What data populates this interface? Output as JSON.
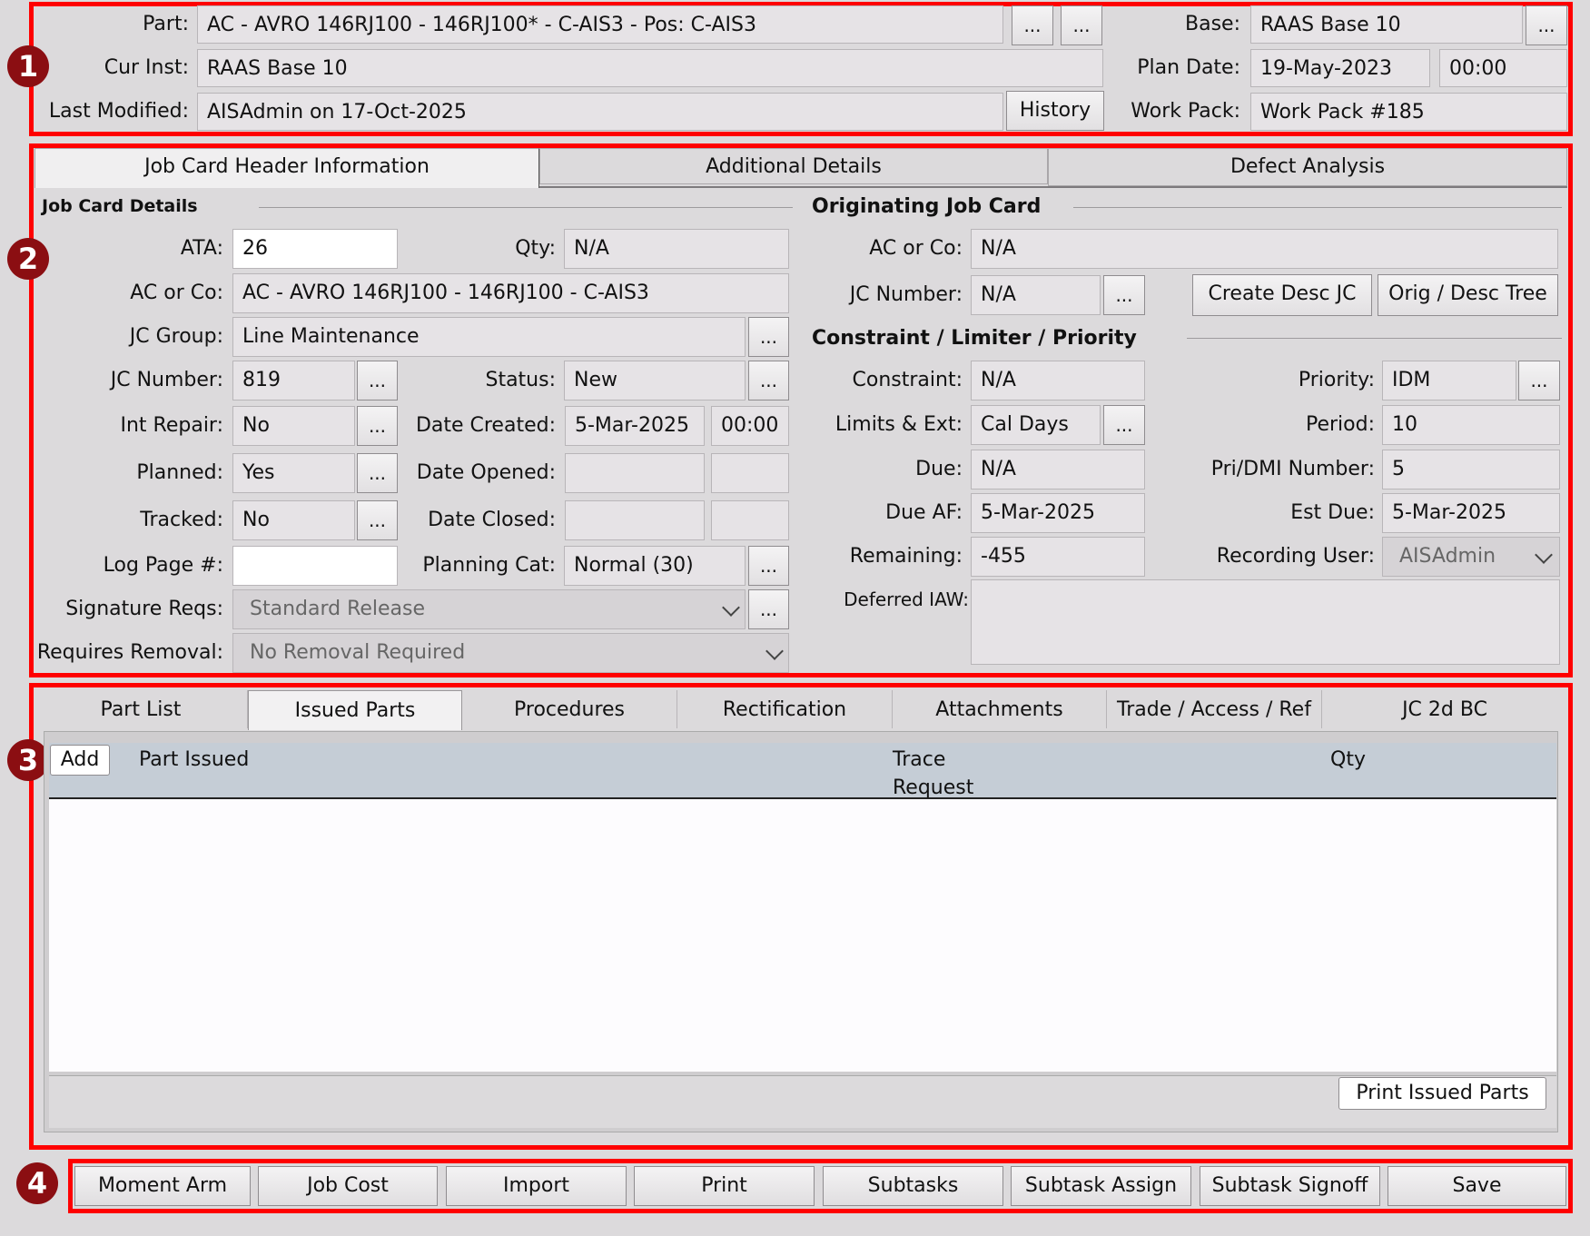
{
  "header": {
    "part_label": "Part:",
    "part_value": "AC - AVRO 146RJ100 - 146RJ100* - C-AIS3 - Pos: C-AIS3",
    "cur_inst_label": "Cur Inst:",
    "cur_inst_value": "RAAS Base 10",
    "last_modified_label": "Last Modified:",
    "last_modified_value": "AISAdmin on 17-Oct-2025",
    "history_button": "History",
    "base_label": "Base:",
    "base_value": "RAAS Base 10",
    "plan_date_label": "Plan Date:",
    "plan_date_value": "19-May-2023",
    "plan_time_value": "00:00",
    "work_pack_label": "Work Pack:",
    "work_pack_value": "Work Pack #185",
    "ellipsis": "..."
  },
  "badges": [
    "1",
    "2",
    "3",
    "4"
  ],
  "top_tabs": [
    "Job Card Header Information",
    "Additional Details",
    "Defect Analysis"
  ],
  "job_card_details": {
    "section_title": "Job Card Details",
    "ata_label": "ATA:",
    "ata_value": "26",
    "qty_label": "Qty:",
    "qty_value": "N/A",
    "ac_or_co_label": "AC or Co:",
    "ac_or_co_value": "AC - AVRO 146RJ100 - 146RJ100 - C-AIS3",
    "jc_group_label": "JC Group:",
    "jc_group_value": "Line Maintenance",
    "jc_number_label": "JC Number:",
    "jc_number_value": "819",
    "status_label": "Status:",
    "status_value": "New",
    "int_repair_label": "Int Repair:",
    "int_repair_value": "No",
    "date_created_label": "Date Created:",
    "date_created_value": "5-Mar-2025",
    "time_created_value": "00:00",
    "planned_label": "Planned:",
    "planned_value": "Yes",
    "date_opened_label": "Date Opened:",
    "date_opened_value": "",
    "time_opened_value": "",
    "tracked_label": "Tracked:",
    "tracked_value": "No",
    "date_closed_label": "Date Closed:",
    "date_closed_value": "",
    "time_closed_value": "",
    "log_page_label": "Log Page #:",
    "log_page_value": "",
    "planning_cat_label": "Planning Cat:",
    "planning_cat_value": "Normal (30)",
    "signature_reqs_label": "Signature Reqs:",
    "signature_reqs_value": "Standard Release",
    "requires_removal_label": "Requires Removal:",
    "requires_removal_value": "No Removal Required"
  },
  "originating_job_card": {
    "section_title": "Originating Job Card",
    "ac_or_co_label": "AC or Co:",
    "ac_or_co_value": "N/A",
    "jc_number_label": "JC Number:",
    "jc_number_value": "N/A",
    "create_desc_jc_button": "Create Desc JC",
    "orig_desc_tree_button": "Orig / Desc Tree"
  },
  "constraint_limiter": {
    "section_title": "Constraint / Limiter / Priority",
    "constraint_label": "Constraint:",
    "constraint_value": "N/A",
    "priority_label": "Priority:",
    "priority_value": "IDM",
    "limits_ext_label": "Limits & Ext:",
    "limits_ext_value": "Cal Days",
    "period_label": "Period:",
    "period_value": "10",
    "due_label": "Due:",
    "due_value": "N/A",
    "pri_dmi_label": "Pri/DMI Number:",
    "pri_dmi_value": "5",
    "due_af_label": "Due AF:",
    "due_af_value": "5-Mar-2025",
    "est_due_label": "Est Due:",
    "est_due_value": "5-Mar-2025",
    "remaining_label": "Remaining:",
    "remaining_value": "-455",
    "recording_user_label": "Recording User:",
    "recording_user_value": "AISAdmin",
    "deferred_iaw_label": "Deferred IAW:",
    "deferred_iaw_value": ""
  },
  "bottom_tabs": [
    "Part List",
    "Issued Parts",
    "Procedures",
    "Rectification",
    "Attachments",
    "Trade / Access / Ref",
    "JC 2d BC"
  ],
  "issued_parts": {
    "add_button": "Add",
    "col_part_issued": "Part Issued",
    "col_trace_line1": "Trace",
    "col_trace_line2": "Request",
    "col_qty": "Qty",
    "print_button": "Print Issued Parts"
  },
  "footer_buttons": [
    "Moment Arm",
    "Job Cost",
    "Import",
    "Print",
    "Subtasks",
    "Subtask Assign",
    "Subtask Signoff",
    "Save"
  ]
}
